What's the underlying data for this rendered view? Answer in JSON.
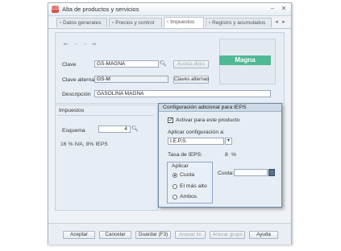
{
  "window": {
    "title": "Alta de productos y servicios",
    "app_icon": "CG"
  },
  "tabs": [
    {
      "label": "Datos generales",
      "icon": "doc-icon"
    },
    {
      "label": "Precios y control",
      "icon": "doc-icon"
    },
    {
      "label": "Impuestos",
      "icon": "doc-icon"
    },
    {
      "label": "Registro y acumulados",
      "icon": "doc-icon"
    }
  ],
  "product": {
    "clave_label": "Clave",
    "clave_value": "GS-MAGNA",
    "clave_alterna_label": "Clave alterna",
    "clave_alterna_value": "GS-M",
    "descripcion_label": "Descripción",
    "descripcion_value": "GASOLINA MAGNA",
    "asocia_docs_button": "Asocia docs",
    "claves_alternas_button": "Claves alternas",
    "logo_text": "Magna"
  },
  "impuestos": {
    "section_title": "Impuestos",
    "esquema_label": "Esquema",
    "esquema_value": "4",
    "summary": "16 % IVA, 8% IEPS"
  },
  "popup": {
    "title": "Configuración adicional para IEPS",
    "activar_label": "Activar para este producto",
    "activar_checked": true,
    "aplicar_config_label": "Aplicar configuración a:",
    "aplicar_config_value": "I.E.P.S.",
    "tasa_label": "Tasa de IEPS:",
    "tasa_value": "8",
    "tasa_unit": "%",
    "aplicar_group_title": "Aplicar",
    "options": [
      "Cuota",
      "El más alto",
      "Ambos"
    ],
    "selected_option": "Cuota",
    "cuota_label": "Cuota:",
    "cuota_value": ""
  },
  "footer": {
    "aceptar": "Aceptar",
    "cancelar": "Cancelar",
    "guardar": "Guardar (F3)",
    "anexar_lin": "Anexar lin",
    "anexar_grupo": "Anexar grupo",
    "ayuda": "Ayuda"
  },
  "colors": {
    "logo_bg": "#4fb894",
    "window_bg": "#eef2f6",
    "popup_border": "#6f86a3"
  }
}
